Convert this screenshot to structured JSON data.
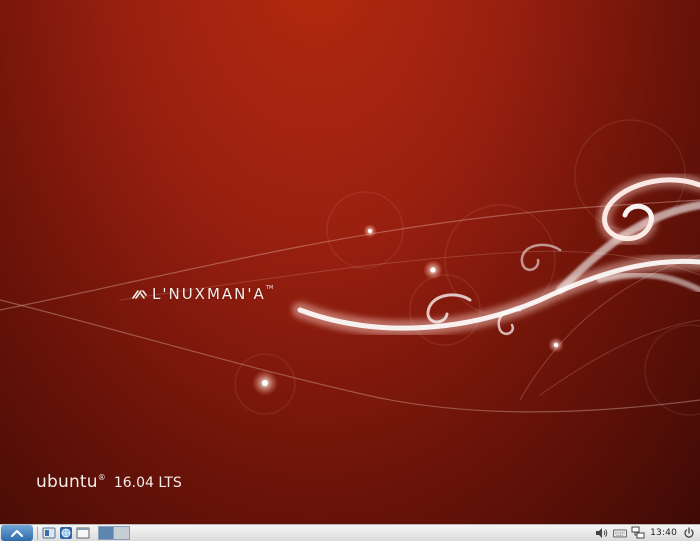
{
  "wallpaper": {
    "brand_text": "L'NUXMAN'A",
    "brand_tm": "TM",
    "os_name": "ubuntu",
    "os_registered": "®",
    "os_version": "16.04 LTS"
  },
  "taskbar": {
    "clock": "13:40"
  },
  "colors": {
    "wallpaper_top": "#b52a0e",
    "wallpaper_bottom": "#3f0a05",
    "taskbar_bg": "#e6e6e6",
    "start_button": "#3b78b8"
  },
  "icons": {
    "start": "menu-icon",
    "file_manager": "file-manager-icon",
    "browser": "web-browser-icon",
    "terminal": "terminal-icon",
    "volume": "volume-icon",
    "keyboard": "keyboard-icon",
    "network": "network-icon",
    "power": "power-icon"
  }
}
